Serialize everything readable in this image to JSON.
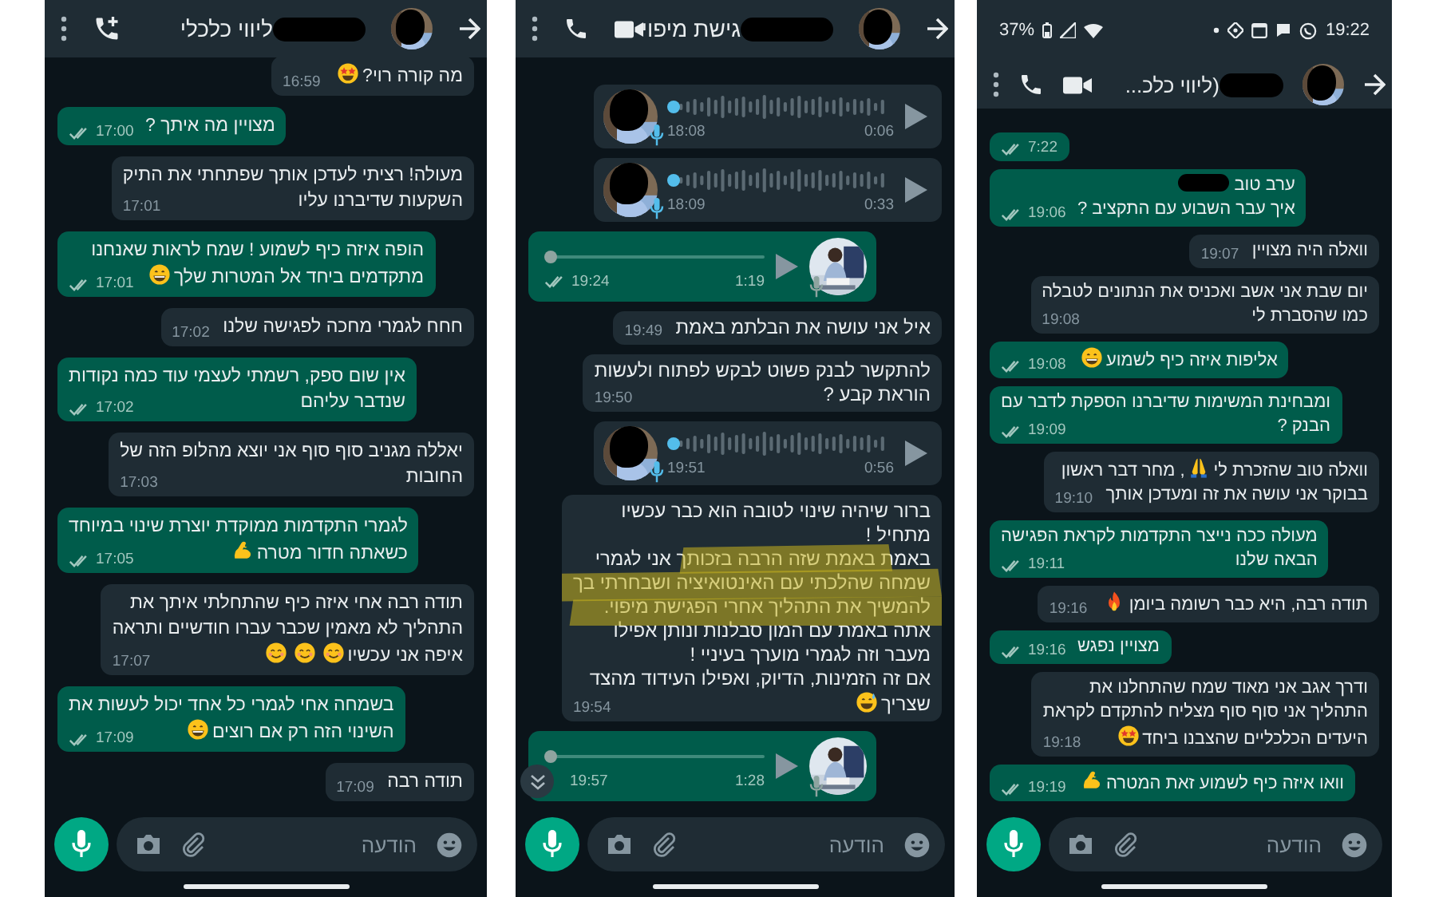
{
  "panels": [
    {
      "status_bar": {
        "battery": "37%",
        "time": "19:22"
      },
      "header": {
        "title": "(ליווי כלכ...",
        "name_hidden": true,
        "actions": [
          {
            "kind": "menu"
          },
          {
            "kind": "call"
          },
          {
            "kind": "video"
          }
        ]
      },
      "messages": [
        {
          "kind": "text",
          "outgoing": true,
          "time": "7:22",
          "read": false
        },
        {
          "kind": "text",
          "outgoing": true,
          "parts": [
            {
              "kind": "text",
              "text": "ערב טוב"
            },
            {
              "kind": "redaction"
            },
            {
              "kind": "break"
            },
            {
              "kind": "text",
              "text": "איך עבר השבוע עם התקציב ?"
            }
          ],
          "time": "19:06",
          "read": false
        },
        {
          "kind": "text",
          "outgoing": false,
          "parts": [
            {
              "kind": "text",
              "text": "וואלה היה מצויין"
            }
          ],
          "time": "19:07"
        },
        {
          "kind": "text",
          "outgoing": false,
          "parts": [
            {
              "kind": "text",
              "text": "יום שבת אני אשב ואכניס את הנתונים לטבלה"
            },
            {
              "kind": "break"
            },
            {
              "kind": "text",
              "text": "כמו שהסברת לי"
            }
          ],
          "time": "19:08"
        },
        {
          "kind": "text",
          "outgoing": true,
          "parts": [
            {
              "kind": "text",
              "text": "אליפות איזה כיף לשמוע"
            },
            {
              "kind": "emoji-grin"
            }
          ],
          "time": "19:08",
          "read": false
        },
        {
          "kind": "text",
          "outgoing": true,
          "parts": [
            {
              "kind": "text",
              "text": "ומבחינת המשימות שדיברנו הספקת לדבר עם"
            },
            {
              "kind": "break"
            },
            {
              "kind": "text",
              "text": "הבנק ?"
            }
          ],
          "time": "19:09",
          "read": false
        },
        {
          "kind": "text",
          "outgoing": false,
          "parts": [
            {
              "kind": "text",
              "text": "וואלה טוב שהזכרת לי"
            },
            {
              "kind": "emoji-pray"
            },
            {
              "kind": "text",
              "text": ", מחר דבר ראשון"
            },
            {
              "kind": "break"
            },
            {
              "kind": "text",
              "text": "בבוקר אני עושה את זה ומעדכן אותך"
            }
          ],
          "time": "19:10"
        },
        {
          "kind": "text",
          "outgoing": true,
          "parts": [
            {
              "kind": "text",
              "text": "מעולה ככה נייצר התקדמות לקראת הפגישה"
            },
            {
              "kind": "break"
            },
            {
              "kind": "text",
              "text": "הבאה שלנו"
            }
          ],
          "time": "19:11",
          "read": false
        },
        {
          "kind": "text",
          "outgoing": false,
          "parts": [
            {
              "kind": "text",
              "text": "תודה רבה, היא כבר רשומה ביומן"
            },
            {
              "kind": "emoji-fire"
            }
          ],
          "time": "19:16"
        },
        {
          "kind": "text",
          "outgoing": true,
          "parts": [
            {
              "kind": "text",
              "text": "מצויין נפגש"
            }
          ],
          "time": "19:16",
          "read": false
        },
        {
          "kind": "text",
          "outgoing": false,
          "parts": [
            {
              "kind": "text",
              "text": "ודרך אגב אני מאוד שמח שהתחלנו את"
            },
            {
              "kind": "break"
            },
            {
              "kind": "text",
              "text": "התהליך אני סוף סוף מצליח להתקדם לקראת"
            },
            {
              "kind": "break"
            },
            {
              "kind": "text",
              "text": "היעדים הכלכליים שהצבנו ביחד"
            },
            {
              "kind": "emoji-star-eyes"
            }
          ],
          "time": "19:18"
        },
        {
          "kind": "text",
          "outgoing": true,
          "parts": [
            {
              "kind": "text",
              "text": "וואו איזה כיף לשמוע זאת המטרה"
            },
            {
              "kind": "emoji-muscle"
            }
          ],
          "time": "19:19",
          "read": false
        }
      ],
      "composer": {
        "placeholder": "הודעה"
      }
    },
    {
      "header": {
        "title": "גישת מיפוי",
        "name_hidden": true,
        "actions": [
          {
            "kind": "menu"
          },
          {
            "kind": "call"
          },
          {
            "kind": "video"
          }
        ]
      },
      "messages": [
        {
          "kind": "voice",
          "outgoing": false,
          "time": "18:08",
          "duration": "0:06",
          "avatar_hidden": true
        },
        {
          "kind": "voice",
          "outgoing": false,
          "time": "18:09",
          "duration": "0:33",
          "avatar_hidden": true
        },
        {
          "kind": "voice",
          "outgoing": true,
          "time": "19:24",
          "duration": "1:19",
          "read": false
        },
        {
          "kind": "text",
          "outgoing": false,
          "parts": [
            {
              "kind": "text",
              "text": "איל אני עושה את הבלתמ באמת"
            }
          ],
          "time": "19:49"
        },
        {
          "kind": "text",
          "outgoing": false,
          "parts": [
            {
              "kind": "text",
              "text": "להתקשר לבנק פשוט לבקש לפתוח ולעשות"
            },
            {
              "kind": "break"
            },
            {
              "kind": "text",
              "text": "הוראת קבע ?"
            }
          ],
          "time": "19:50"
        },
        {
          "kind": "voice",
          "outgoing": false,
          "time": "19:51",
          "duration": "0:56",
          "avatar_hidden": true
        },
        {
          "kind": "text",
          "outgoing": false,
          "highlighted": true,
          "parts": [
            {
              "kind": "text",
              "text": "ברור שיהיה שינוי לטובה הוא כבר עכשיו"
            },
            {
              "kind": "break"
            },
            {
              "kind": "text",
              "text": "מתחיל !"
            },
            {
              "kind": "break"
            },
            {
              "kind": "text",
              "text": "באמת באמת שזה הרבה בזכותך אני לגמרי"
            },
            {
              "kind": "break"
            },
            {
              "kind": "text",
              "text": "שמחה שהלכתי עם האינטואיציה ושבחרתי בך"
            },
            {
              "kind": "break"
            },
            {
              "kind": "text",
              "text": "להמשיך את התהליך אחרי הפגישת מיפוי."
            },
            {
              "kind": "break"
            },
            {
              "kind": "text",
              "text": "אתה באמת עם המון סבלנות ונותן אפילו"
            },
            {
              "kind": "break"
            },
            {
              "kind": "text",
              "text": "מעבר וזה לגמרי מוערך בעיניי !"
            },
            {
              "kind": "break"
            },
            {
              "kind": "text",
              "text": "אם זה הזמינות, הדיוק, ואפילו העידוד מהצד"
            },
            {
              "kind": "break"
            },
            {
              "kind": "text",
              "text": "שצריך"
            },
            {
              "kind": "emoji-sweat"
            }
          ],
          "time": "19:54"
        },
        {
          "kind": "voice",
          "outgoing": true,
          "time": "19:57",
          "duration": "1:28"
        }
      ],
      "scroll_button": true,
      "composer": {
        "placeholder": "הודעה"
      }
    },
    {
      "header": {
        "title": "ליווי כלכלי",
        "name_hidden": true,
        "actions": [
          {
            "kind": "menu"
          },
          {
            "kind": "add-call"
          }
        ]
      },
      "messages": [
        {
          "kind": "text",
          "outgoing": false,
          "parts": [
            {
              "kind": "text",
              "text": "מה קורה רוי?"
            },
            {
              "kind": "emoji-star-eyes"
            }
          ],
          "time": "16:59"
        },
        {
          "kind": "text",
          "outgoing": true,
          "parts": [
            {
              "kind": "text",
              "text": "מצויין מה איתך ?"
            }
          ],
          "time": "17:00",
          "read": false
        },
        {
          "kind": "text",
          "outgoing": false,
          "parts": [
            {
              "kind": "text",
              "text": "מעולה! רציתי לעדכן אותך שפתחתי את התיק"
            },
            {
              "kind": "break"
            },
            {
              "kind": "text",
              "text": "השקעות שדיברנו עליו"
            }
          ],
          "time": "17:01"
        },
        {
          "kind": "text",
          "outgoing": true,
          "parts": [
            {
              "kind": "text",
              "text": "הופה איזה כיף לשמוע ! שמח לראות שאנחנו"
            },
            {
              "kind": "break"
            },
            {
              "kind": "text",
              "text": "מתקדמים ביחד אל המטרות שלך"
            },
            {
              "kind": "emoji-grin"
            }
          ],
          "time": "17:01",
          "read": false
        },
        {
          "kind": "text",
          "outgoing": false,
          "parts": [
            {
              "kind": "text",
              "text": "חחח לגמרי מחכה לפגישה שלנו"
            }
          ],
          "time": "17:02"
        },
        {
          "kind": "text",
          "outgoing": true,
          "parts": [
            {
              "kind": "text",
              "text": "אין שום ספק, רשמתי לעצמי עוד כמה נקודות"
            },
            {
              "kind": "break"
            },
            {
              "kind": "text",
              "text": "שנדבר עליהם"
            }
          ],
          "time": "17:02",
          "read": false
        },
        {
          "kind": "text",
          "outgoing": false,
          "parts": [
            {
              "kind": "text",
              "text": "יאללה מגניב סוף סוף אני יוצא מהלופ הזה של"
            },
            {
              "kind": "break"
            },
            {
              "kind": "text",
              "text": "החובות"
            }
          ],
          "time": "17:03"
        },
        {
          "kind": "text",
          "outgoing": true,
          "parts": [
            {
              "kind": "text",
              "text": "לגמרי התקדמות ממוקדת יוצרת שינוי במיוחד"
            },
            {
              "kind": "break"
            },
            {
              "kind": "text",
              "text": "כשאתה חדור מטרה"
            },
            {
              "kind": "emoji-muscle"
            }
          ],
          "time": "17:05",
          "read": false
        },
        {
          "kind": "text",
          "outgoing": false,
          "parts": [
            {
              "kind": "text",
              "text": "תודה רבה אחי איזה כיף שהתחלתי איתך את"
            },
            {
              "kind": "break"
            },
            {
              "kind": "text",
              "text": "התהליך לא מאמין שכבר עברו חודשיים ותראה"
            },
            {
              "kind": "break"
            },
            {
              "kind": "text",
              "text": "איפה אני עכשיו"
            },
            {
              "kind": "emoji-smile"
            },
            {
              "kind": "emoji-smile"
            },
            {
              "kind": "emoji-smile"
            }
          ],
          "time": "17:07"
        },
        {
          "kind": "text",
          "outgoing": true,
          "parts": [
            {
              "kind": "text",
              "text": "בשמחה אחי לגמרי כל אחד יכול לעשות את"
            },
            {
              "kind": "break"
            },
            {
              "kind": "text",
              "text": "השינוי הזה רק אם רוצים"
            },
            {
              "kind": "emoji-grin"
            }
          ],
          "time": "17:09",
          "read": false
        },
        {
          "kind": "text",
          "outgoing": false,
          "parts": [
            {
              "kind": "text",
              "text": "תודה רבה"
            }
          ],
          "time": "17:09"
        }
      ],
      "composer": {
        "placeholder": "הודעה"
      }
    }
  ]
}
